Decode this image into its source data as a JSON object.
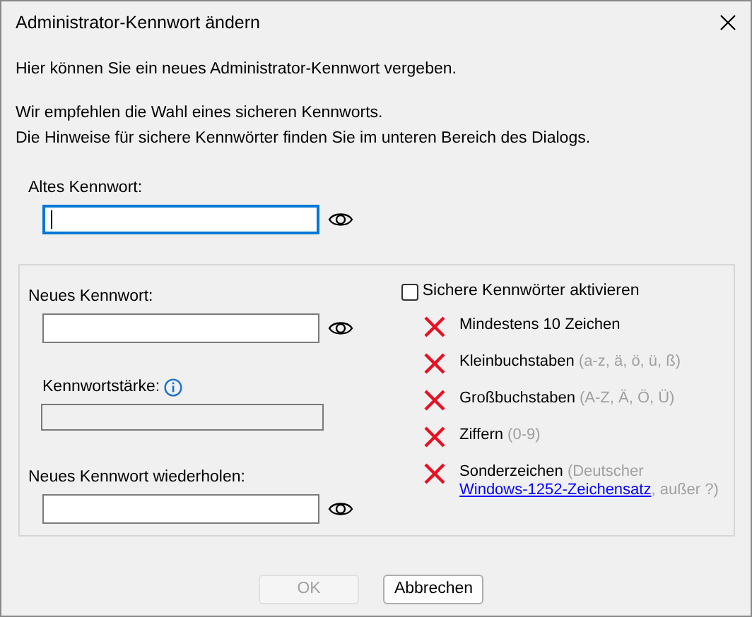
{
  "window": {
    "title": "Administrator-Kennwort ändern"
  },
  "intro": [
    "Hier können Sie ein neues Administrator-Kennwort vergeben.",
    "Wir empfehlen die Wahl eines sicheren Kennworts.",
    "Die Hinweise für sichere Kennwörter finden Sie im unteren Bereich des Dialogs."
  ],
  "old_password": {
    "label": "Altes Kennwort:",
    "focused": true
  },
  "new_password": {
    "label": "Neues Kennwort:",
    "focused": false
  },
  "strength": {
    "label": "Kennwortstärke:"
  },
  "repeat_password": {
    "label": "Neues Kennwort wiederholen:",
    "focused": false
  },
  "secure_checkbox": {
    "label": "Sichere Kennwörter aktivieren",
    "checked": false
  },
  "requirements": [
    {
      "text": "Mindestens 10 Zeichen",
      "met": false
    },
    {
      "text": "Kleinbuchstaben",
      "hint": "(a-z, ä, ö, ü, ß)",
      "met": false
    },
    {
      "text": "Großbuchstaben",
      "hint": "(A-Z, Ä, Ö, Ü)",
      "met": false
    },
    {
      "text": "Ziffern",
      "hint": "(0-9)",
      "met": false
    },
    {
      "text": "Sonderzeichen",
      "hint": "(Deutscher",
      "link": "Windows-1252-Zeichensatz",
      "hint_after": ", außer ?)",
      "met": false
    }
  ],
  "buttons": [
    {
      "label": "OK",
      "disabled": true
    },
    {
      "label": "Abbrechen",
      "disabled": false
    }
  ]
}
